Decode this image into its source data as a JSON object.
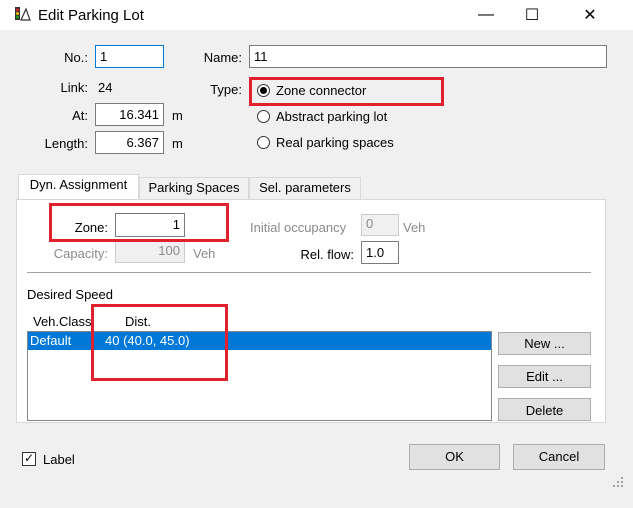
{
  "window": {
    "title": "Edit Parking Lot",
    "icon": "parking-lot-icon",
    "minimize_glyph": "—",
    "maximize_glyph": "☐",
    "close_glyph": "✕"
  },
  "form": {
    "no_label": "No.:",
    "no_value": "1",
    "name_label": "Name:",
    "name_value": "11",
    "link_label": "Link:",
    "link_value": "24",
    "type_label": "Type:",
    "type_options": [
      "Zone connector",
      "Abstract parking lot",
      "Real parking spaces"
    ],
    "type_selected": "Zone connector",
    "at_label": "At:",
    "at_value": "16.341",
    "at_unit": "m",
    "length_label": "Length:",
    "length_value": "6.367",
    "length_unit": "m"
  },
  "tabs": [
    "Dyn. Assignment",
    "Parking Spaces",
    "Sel. parameters"
  ],
  "active_tab": "Dyn. Assignment",
  "dyn": {
    "zone_label": "Zone:",
    "zone_value": "1",
    "capacity_label": "Capacity:",
    "capacity_value": "100",
    "capacity_unit": "Veh",
    "initial_occupancy_label": "Initial occupancy",
    "initial_occupancy_value": "0",
    "initial_occupancy_unit": "Veh",
    "rel_flow_label": "Rel. flow:",
    "rel_flow_value": "1.0"
  },
  "desired_speed": {
    "heading": "Desired Speed",
    "columns": [
      "Veh.Class",
      "Dist."
    ],
    "rows": [
      {
        "veh_class": "Default",
        "dist": "40 (40.0, 45.0)"
      }
    ],
    "new_button": "New ...",
    "edit_button": "Edit ...",
    "delete_button": "Delete"
  },
  "footer": {
    "label_checkbox": "Label",
    "label_checked": true,
    "check_glyph": "✓",
    "ok_button": "OK",
    "cancel_button": "Cancel"
  },
  "colors": {
    "highlight": "#e0202c",
    "selection": "#0078d7",
    "dialog_bg": "#f0f0f0"
  }
}
